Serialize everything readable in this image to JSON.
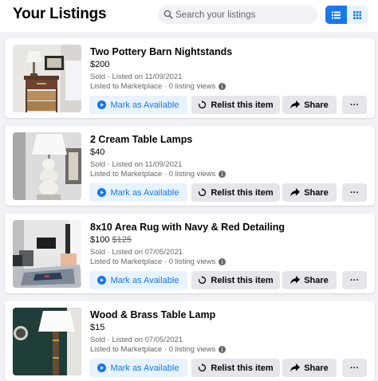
{
  "header": {
    "title": "Your Listings",
    "search_placeholder": "Search your listings",
    "view_toggle": [
      "list-view",
      "grid-view"
    ],
    "active_view": "list-view"
  },
  "colors": {
    "accent": "#1877f2",
    "accent_light": "#e7f3ff",
    "secondary_button": "#e4e6eb",
    "muted_text": "#65676b",
    "page_bg": "#f0f2f5"
  },
  "actions": {
    "mark_available": "Mark as Available",
    "relist": "Relist this item",
    "share": "Share",
    "more": "···"
  },
  "listings": [
    {
      "title": "Two Pottery Barn Nightstands",
      "price": "$200",
      "original_price": "",
      "status_line": "Sold · Listed on 11/09/2021",
      "views_line": "Listed to Marketplace · 0 listing views"
    },
    {
      "title": "2 Cream Table Lamps",
      "price": "$40",
      "original_price": "",
      "status_line": "Sold · Listed on 11/09/2021",
      "views_line": "Listed to Marketplace · 0 listing views"
    },
    {
      "title": "8x10 Area Rug with Navy & Red Detailing",
      "price": "$100",
      "original_price": "$125",
      "status_line": "Sold · Listed on 07/05/2021",
      "views_line": "Listed to Marketplace · 0 listing views"
    },
    {
      "title": "Wood & Brass Table Lamp",
      "price": "$15",
      "original_price": "",
      "status_line": "Sold · Listed on 07/05/2021",
      "views_line": "Listed to Marketplace · 0 listing views"
    }
  ]
}
